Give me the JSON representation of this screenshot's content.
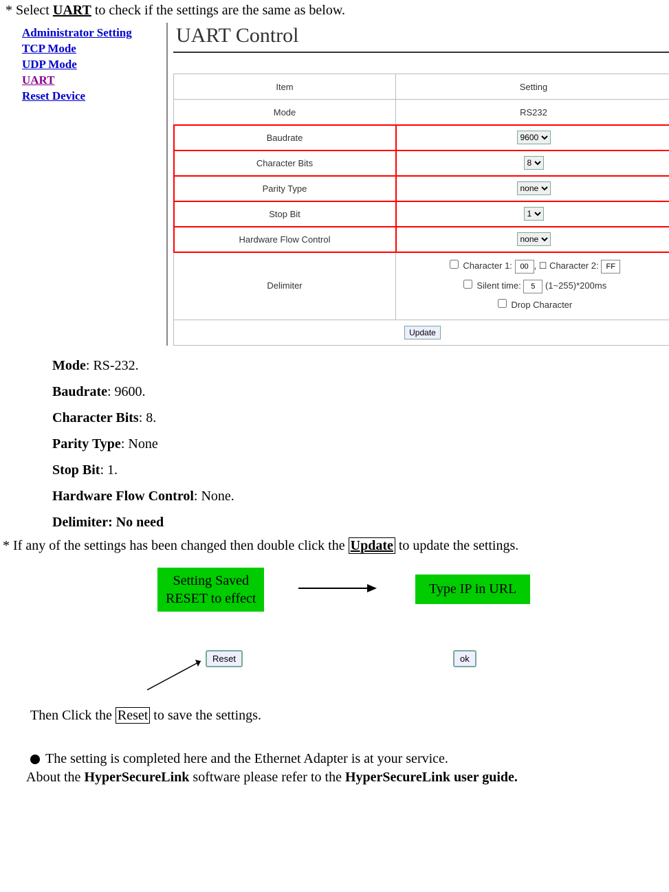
{
  "top_instruction_pre": "* Select ",
  "top_instruction_link": "UART",
  "top_instruction_post": " to check if the settings are the same as below.",
  "nav": {
    "admin": "Administrator Setting",
    "tcp": "TCP Mode",
    "udp": "UDP Mode",
    "uart": "UART",
    "reset": "Reset Device"
  },
  "panel_title": "UART Control",
  "hdr_item": "Item",
  "hdr_setting": "Setting",
  "row_mode_lbl": "Mode",
  "row_mode_val": "RS232",
  "row_baud_lbl": "Baudrate",
  "row_baud_val": "9600",
  "row_char_lbl": "Character Bits",
  "row_char_val": "8",
  "row_parity_lbl": "Parity Type",
  "row_parity_val": "none",
  "row_stop_lbl": "Stop Bit",
  "row_stop_val": "1",
  "row_hw_lbl": "Hardware Flow Control",
  "row_hw_val": "none",
  "row_delim_lbl": "Delimiter",
  "delim_c1": "Character 1:",
  "delim_c1v": "00",
  "delim_c2": ", ☐ Character 2:",
  "delim_c2v": "FF",
  "delim_silent": "Silent time:",
  "delim_silentv": "5",
  "delim_silent_suffix": " (1~255)*200ms",
  "delim_drop": "Drop Character",
  "update_btn": "Update",
  "params": {
    "mode_l": "Mode",
    "mode_v": ": RS-232.",
    "baud_l": "Baudrate",
    "baud_v": ": 9600.",
    "char_l": "Character Bits",
    "char_v": ": 8.",
    "par_l": "Parity Type",
    "par_v": ": None",
    "stop_l": "Stop Bit",
    "stop_v": ": 1.",
    "hw_l": "Hardware Flow Control",
    "hw_v": ": None.",
    "delim_l": "Delimiter: No need"
  },
  "update_line_pre": "* If any of the settings has been changed then double click the ",
  "update_line_link": "Update",
  "update_line_post": " to update the settings.",
  "green1_l1": "Setting Saved",
  "green1_l2": "RESET to effect",
  "green2": "Type IP in URL",
  "btn_reset": "Reset",
  "btn_ok": "ok",
  "reset_line_pre": "Then Click the ",
  "reset_line_link": "Reset",
  "reset_line_post": " to save the settings.",
  "bullet_line": "The setting is completed here and the Ethernet Adapter is at your service.",
  "last_pre": "About the ",
  "last_b1": "HyperSecureLink",
  "last_mid": " software please refer to the ",
  "last_b2": "HyperSecureLink user guide."
}
